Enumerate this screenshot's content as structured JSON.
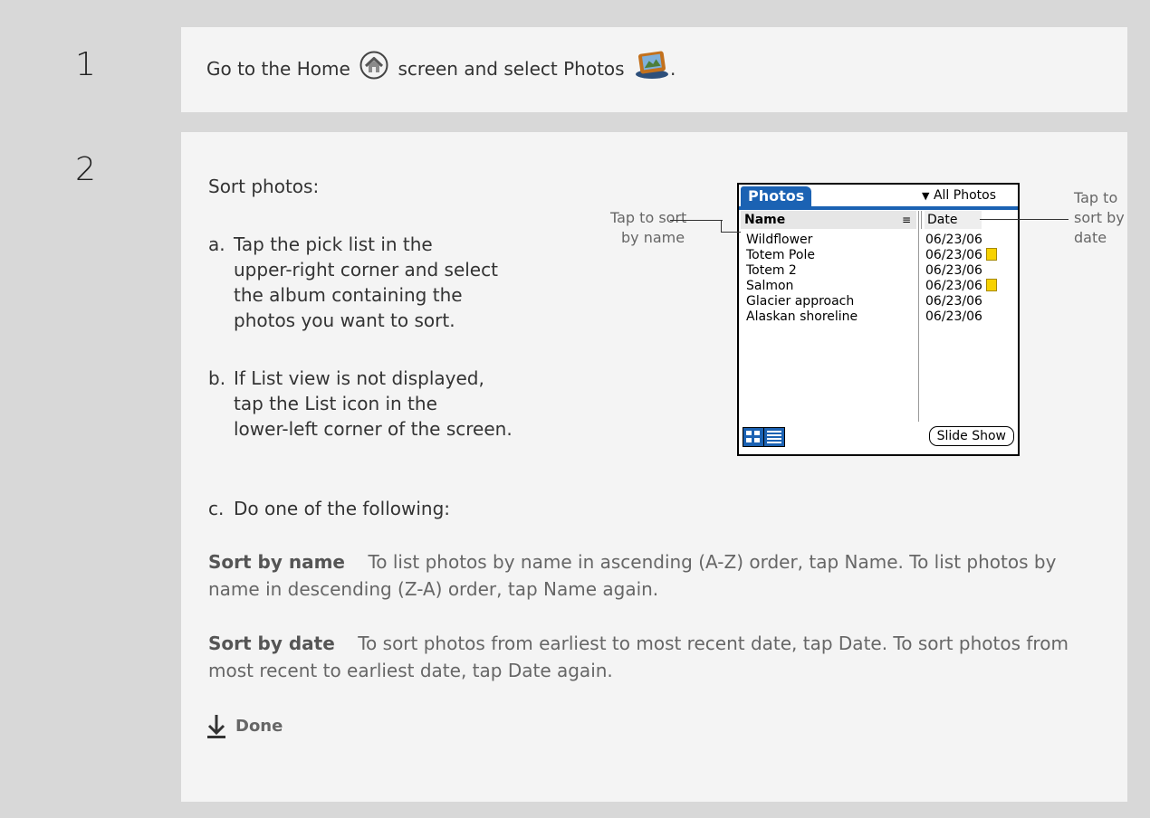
{
  "step1": {
    "number": "1",
    "text_before": "Go to the Home",
    "text_mid": "screen and select Photos",
    "text_after": ".",
    "icons": [
      "home-icon",
      "photos-app-icon"
    ]
  },
  "step2": {
    "number": "2",
    "intro": "Sort photos:",
    "items": [
      {
        "marker": "a.",
        "lines": [
          "Tap the pick list in the",
          "upper-right corner and select",
          "the album containing the",
          "photos you want to sort."
        ]
      },
      {
        "marker": "b.",
        "lines": [
          "If List view is not displayed,",
          "tap the List icon in the",
          "lower-left corner of the screen."
        ]
      },
      {
        "marker": "c.",
        "lines": [
          "Do one of the following:"
        ]
      }
    ],
    "sort_name": {
      "label": "Sort by name",
      "text": "To list photos by name in ascending (A-Z) order, tap Name. To list photos by name in descending (Z-A) order, tap Name again."
    },
    "sort_date": {
      "label": "Sort by date",
      "text": "To sort photos from earliest to most recent date, tap Date. To sort photos from most recent to earliest date, tap Date again."
    },
    "done": "Done"
  },
  "screen": {
    "tab": "Photos",
    "picklist": "All Photos",
    "col_name": "Name",
    "col_date": "Date",
    "rows": [
      {
        "name": "Wildflower",
        "date": "06/23/06",
        "note": false
      },
      {
        "name": "Totem Pole",
        "date": "06/23/06",
        "note": true
      },
      {
        "name": "Totem 2",
        "date": "06/23/06",
        "note": false
      },
      {
        "name": "Salmon",
        "date": "06/23/06",
        "note": true
      },
      {
        "name": "Glacier approach",
        "date": "06/23/06",
        "note": false
      },
      {
        "name": "Alaskan shoreline",
        "date": "06/23/06",
        "note": false
      }
    ],
    "slide_show": "Slide Show"
  },
  "callouts": {
    "left_line1": "Tap to sort",
    "left_line2": "by name",
    "right_line1": "Tap to",
    "right_line2": "sort by",
    "right_line3": "date"
  },
  "colors": {
    "accent": "#1b62b3",
    "note": "#f7d200",
    "panel": "#f4f4f4",
    "frame": "#d8d8d8"
  }
}
